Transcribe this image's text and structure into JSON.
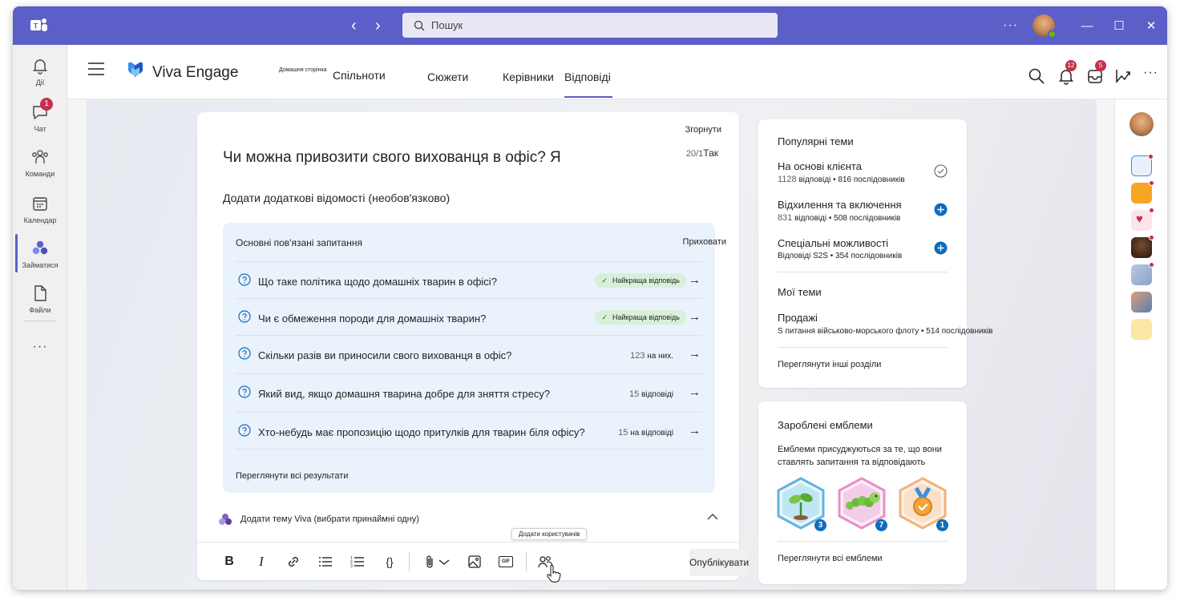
{
  "titlebar": {
    "search_placeholder": "Пошук",
    "more": "···"
  },
  "rail": {
    "items": [
      {
        "label": "Дії",
        "icon": "bell-icon"
      },
      {
        "label": "Чат",
        "icon": "chat-icon",
        "badge": "1"
      },
      {
        "label": "Команди",
        "icon": "teams-icon"
      },
      {
        "label": "Календар",
        "icon": "calendar-icon"
      },
      {
        "label": "Займатися",
        "icon": "engage-icon",
        "active": true
      },
      {
        "label": "Файли",
        "icon": "file-icon"
      }
    ],
    "more": "···"
  },
  "header": {
    "app_name": "Viva Engage",
    "tabs": {
      "home": "Домашня сторінка",
      "communities": "Спільноти",
      "stories": "Сюжети",
      "leaders": "Керівники",
      "answers": "Відповіді"
    },
    "notifications_badge": "12",
    "inbox_badge": "5"
  },
  "composer": {
    "collapse_label": "Згорнути",
    "counter": "20/1",
    "counter_suffix": "Так",
    "question": "Чи можна привозити свого вихованця в офіс? Я",
    "details_placeholder": "Додати додаткові відомості (необов'язково)",
    "related": {
      "title": "Основні пов'язані запитання",
      "hide_label": "Приховати",
      "items": [
        {
          "text": "Що таке політика щодо домашніх тварин в офісі?",
          "pill": "Найкраща відповідь"
        },
        {
          "text": "Чи є обмеження породи для домашніх тварин?",
          "pill": "Найкраща відповідь"
        },
        {
          "text": "Скільки разів ви приносили свого вихованця в офіс?",
          "count": "123",
          "meta": "на них."
        },
        {
          "text": "Який вид, якщо домашня тварина добре для зняття стресу?",
          "count": "15",
          "meta": "відповіді"
        },
        {
          "text": "Хто-небудь має пропозицію щодо притулків для тварин біля офісу?",
          "count": "15",
          "meta": "на відповіді"
        }
      ],
      "see_all": "Переглянути всі результати"
    },
    "viva_topic": "Додати тему Viva (вибрати принаймні одну)",
    "tooltip": "Додати користувачів",
    "publish": "Опублікувати",
    "toolbar": {
      "bold": "B",
      "italic": "I",
      "code": "{}",
      "gif": "GIF"
    }
  },
  "popular_topics": {
    "title": "Популярні теми",
    "items": [
      {
        "title": "На основі клієнта",
        "count": "1128",
        "sub": "відповіді • 816 послідовників",
        "state": "followed"
      },
      {
        "title": "Відхилення та включення",
        "count": "831",
        "sub": "відповіді • 508 послідовників",
        "state": "add"
      },
      {
        "title": "Спеціальні можливості",
        "count": "",
        "sub": "Відповіді S2S • 354 послідовників",
        "state": "add"
      }
    ],
    "my_topics_title": "Мої теми",
    "my_topics": [
      {
        "title": "Продажі",
        "sub": "S питання військово-морського флоту • 514 послідовників"
      }
    ],
    "see_more": "Переглянути інші розділи"
  },
  "badges": {
    "title": "Зароблені емблеми",
    "description": "Емблеми присуджуються за те, що вони ставлять запитання та відповідають",
    "items": [
      {
        "icon": "sprout-badge-icon",
        "count": "3",
        "color": "#5fb4e0"
      },
      {
        "icon": "caterpillar-badge-icon",
        "count": "7",
        "color": "#e88fc8"
      },
      {
        "icon": "medal-badge-icon",
        "count": "1",
        "color": "#f2b37a"
      }
    ],
    "see_all": "Переглянути всі емблеми"
  },
  "colors": {
    "brand": "#5b5fc7",
    "accent_blue": "#0f6cbd",
    "badge_red": "#c4314b",
    "related_bg": "#eaf2fb",
    "pill_green": "#d8efd9"
  }
}
